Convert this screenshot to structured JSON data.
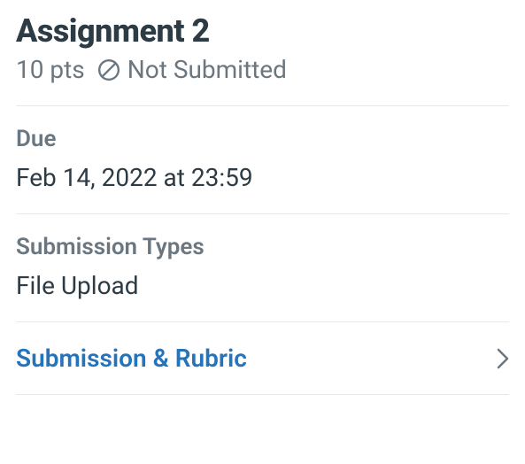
{
  "assignment": {
    "title": "Assignment 2",
    "points": "10 pts",
    "status": "Not Submitted"
  },
  "due": {
    "label": "Due",
    "value": "Feb 14, 2022 at 23:59"
  },
  "submission_types": {
    "label": "Submission Types",
    "value": "File Upload"
  },
  "link": {
    "label": "Submission & Rubric"
  }
}
